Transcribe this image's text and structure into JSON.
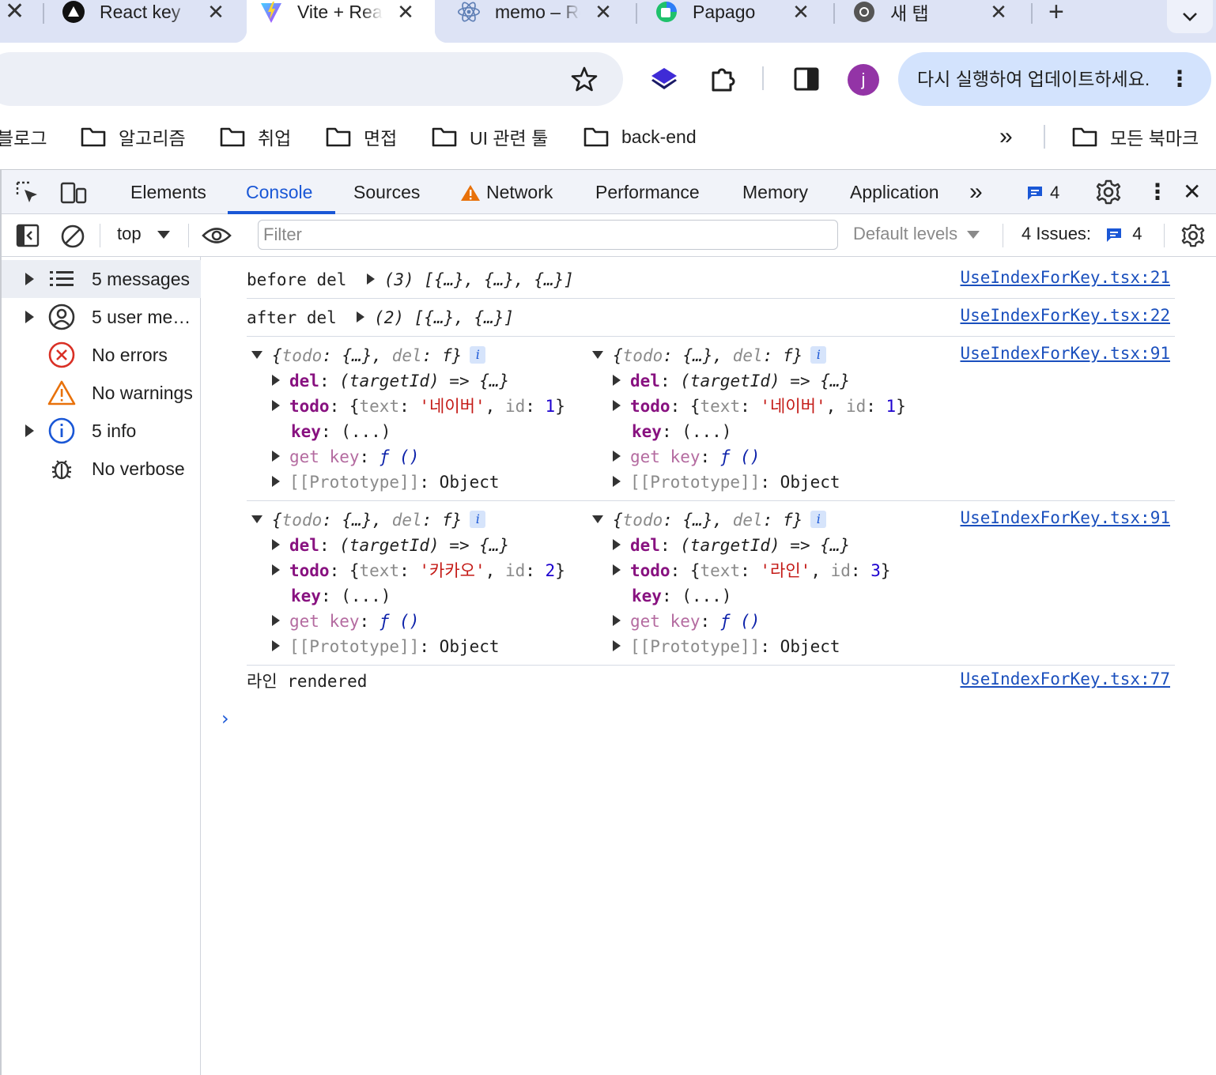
{
  "tabs": [
    {
      "title": "React key",
      "favicon": "triangle-logo-icon"
    },
    {
      "title": "Vite + React",
      "favicon": "vite-logo-icon",
      "active": true
    },
    {
      "title": "memo – React",
      "favicon": "react-logo-icon"
    },
    {
      "title": "Papago",
      "favicon": "papago-logo-icon"
    },
    {
      "title": "새 탭",
      "favicon": "chrome-logo-icon"
    }
  ],
  "tab_close_glyph": "✕",
  "new_tab_glyph": "+",
  "toolbar": {
    "avatar_letter": "j",
    "update_label": "다시 실행하여 업데이트하세요.",
    "update_menu_glyph": "⋮"
  },
  "bookmarks": {
    "first_partial": "블로그",
    "items": [
      "알고리즘",
      "취업",
      "면접",
      "UI 관련 툴",
      "back-end"
    ],
    "overflow_glyph": "»",
    "all_bookmarks": "모든 북마크"
  },
  "devtools": {
    "tabs": [
      "Elements",
      "Console",
      "Sources",
      "Network",
      "Performance",
      "Memory",
      "Application"
    ],
    "active_tab": "Console",
    "more_tabs_glyph": "»",
    "issues_count": "4",
    "close_glyph": "✕",
    "menu_glyph": "⋮"
  },
  "filterbar": {
    "context": "top",
    "filter_placeholder": "Filter",
    "levels": "Default levels",
    "issues_label": "4 Issues:",
    "issues_count": "4"
  },
  "sidebar": [
    {
      "label": "5 messages",
      "icon": "list-icon",
      "expandable": true,
      "selected": true
    },
    {
      "label": "5 user me…",
      "icon": "user-circle-icon",
      "expandable": true
    },
    {
      "label": "No errors",
      "icon": "error-circle-icon",
      "expandable": false
    },
    {
      "label": "No warnings",
      "icon": "warning-triangle-icon",
      "expandable": false
    },
    {
      "label": "5 info",
      "icon": "info-circle-icon",
      "expandable": true
    },
    {
      "label": "No verbose",
      "icon": "bug-icon",
      "expandable": false
    }
  ],
  "console": {
    "msg1": {
      "text": "before del",
      "summary": "(3) [{…}, {…}, {…}]",
      "source": "UseIndexForKey.tsx:21"
    },
    "msg2": {
      "text": "after del",
      "summary": "(2) [{…}, {…}]",
      "source": "UseIndexForKey.tsx:22"
    },
    "obj_header": {
      "open": "{",
      "todo": "todo",
      "todo_val": "{…}",
      "del": "del",
      "del_val": "f",
      "close": "}",
      "info": "i"
    },
    "obj_fields": {
      "del_key": "del",
      "del_val": "(targetId) => {…}",
      "todo_key": "todo",
      "text_key": "text",
      "id_key": "id",
      "key_key": "key",
      "key_val": "(...)",
      "getkey_key": "get key",
      "getkey_val": "ƒ ()",
      "proto_key": "[[Prototype]]",
      "proto_val": "Object"
    },
    "group1": {
      "source": "UseIndexForKey.tsx:91",
      "left": {
        "text": "'네이버'",
        "id": "1"
      },
      "right": {
        "text": "'네이버'",
        "id": "1"
      }
    },
    "group2": {
      "source": "UseIndexForKey.tsx:91",
      "left": {
        "text": "'카카오'",
        "id": "2"
      },
      "right": {
        "text": "'라인'",
        "id": "3"
      }
    },
    "msg3": {
      "text": "라인 rendered",
      "source": "UseIndexForKey.tsx:77"
    },
    "prompt_glyph": "›"
  }
}
